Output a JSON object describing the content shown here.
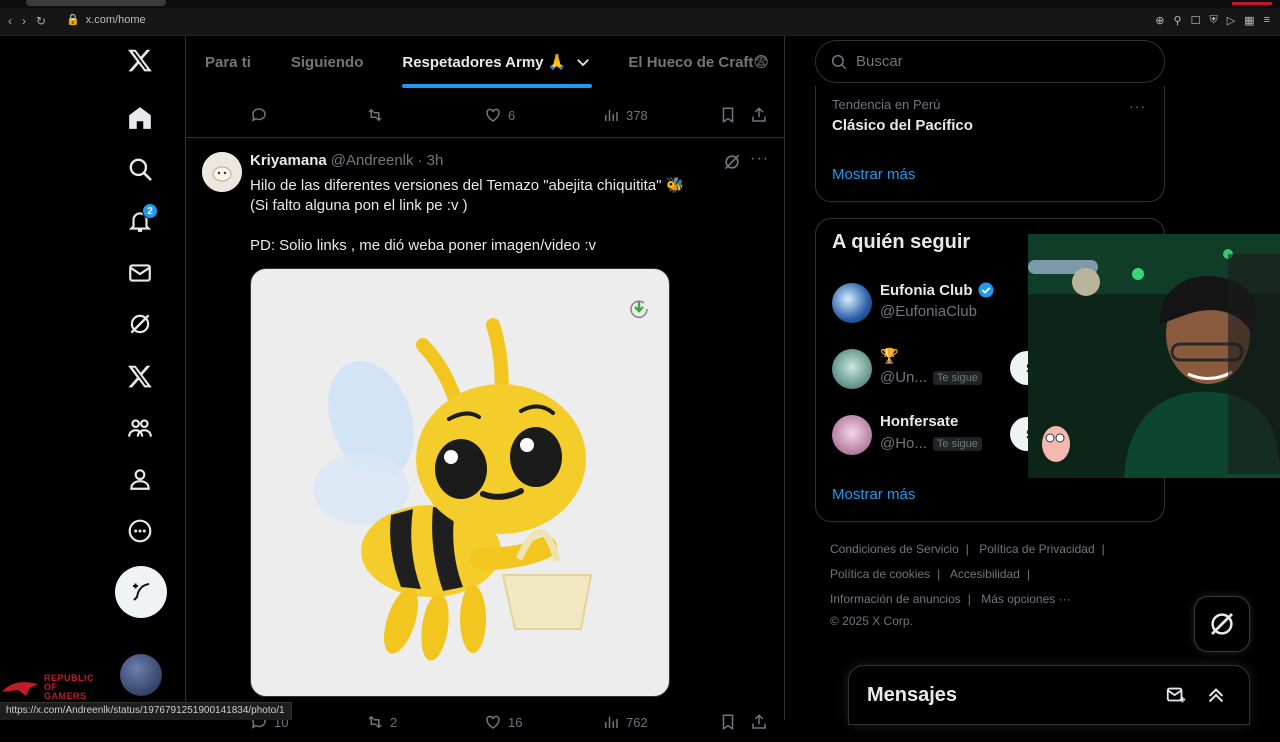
{
  "browser": {
    "url": "x.com/home",
    "status_url": "https://x.com/Andreenlk/status/1976791251900141834/photo/1"
  },
  "sidebar": {
    "notifications_badge": "2",
    "branding": "REPUBLIC OF GAMERS"
  },
  "tabs": [
    {
      "label": "Para ti"
    },
    {
      "label": "Siguiendo"
    },
    {
      "label": "Respetadores Army 🙏"
    },
    {
      "label": "El Hueco de Craft😨"
    }
  ],
  "prev_tweet": {
    "likes": "6",
    "views": "378"
  },
  "tweet": {
    "name": "Kriyamana",
    "handle": "@Andreenlk",
    "time": "· 3h",
    "text": "Hilo de las diferentes versiones del Temazo \"abejita chiquitita\" 🐝\n(Si falto alguna pon el link pe :v )\n\nPD: Solio links , me dió weba poner imagen/video :v",
    "replies": "10",
    "retweets": "2",
    "likes": "16",
    "views": "762"
  },
  "search": {
    "placeholder": "Buscar"
  },
  "trend": {
    "label": "Tendencia en Perú",
    "name": "Clásico del Pacífico",
    "show_more": "Mostrar más"
  },
  "who_to_follow": {
    "title": "A quién seguir",
    "users": [
      {
        "name": "Eufonia Club",
        "handle": "@EufoniaClub",
        "verified": true
      },
      {
        "name": "🏆",
        "handle": "@Un...",
        "follows_you": "Te sigue",
        "button": "Se"
      },
      {
        "name": "Honfersate",
        "handle": "@Ho...",
        "follows_you": "Te sigue",
        "button": "Se"
      }
    ],
    "show_more": "Mostrar más"
  },
  "footer": {
    "links": [
      "Condiciones de Servicio",
      "Política de Privacidad",
      "Política de cookies",
      "Accesibilidad",
      "Información de anuncios",
      "Más opciones ···"
    ],
    "copyright": "© 2025 X Corp."
  },
  "messages": {
    "title": "Mensajes"
  },
  "colors": {
    "accent": "#1d9bf0",
    "background": "#000000",
    "text": "#e7e9ea",
    "muted": "#71767b",
    "border": "#2f3336"
  }
}
